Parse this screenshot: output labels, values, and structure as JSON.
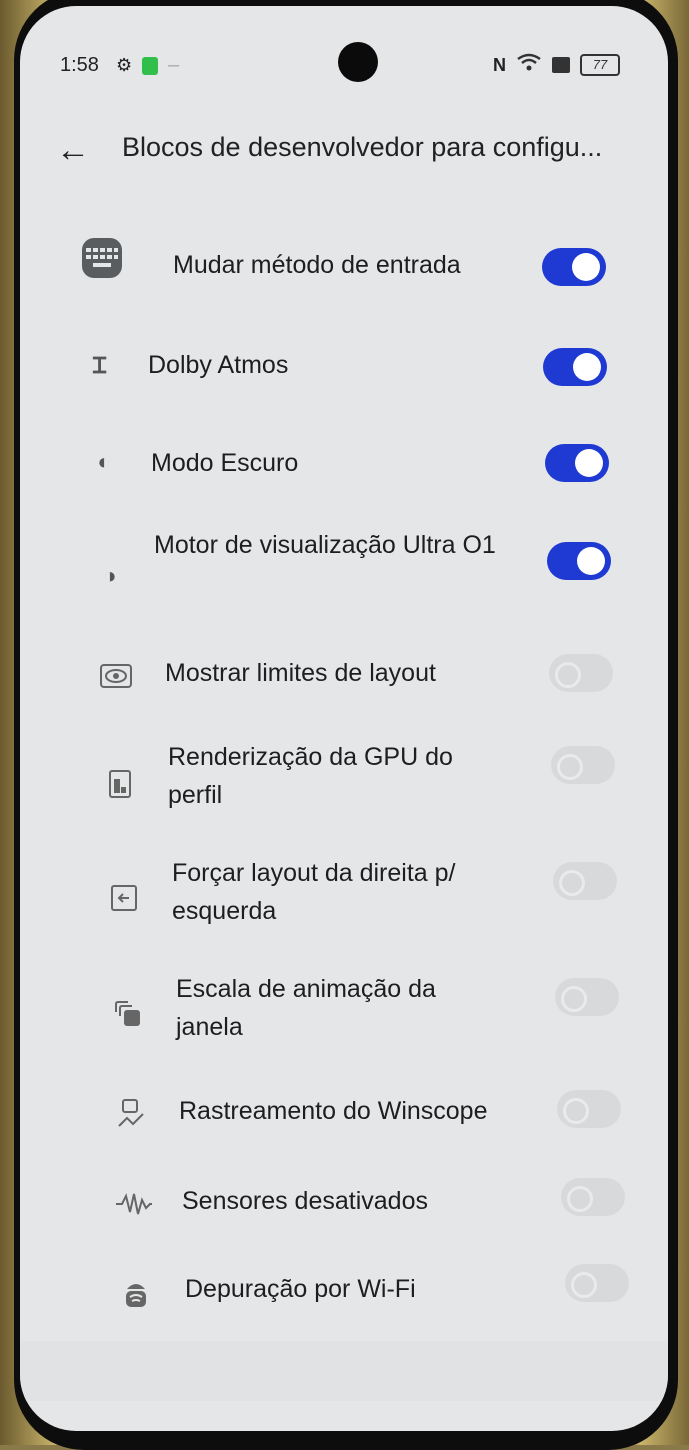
{
  "status_bar": {
    "time": "1:58",
    "battery": "77"
  },
  "header": {
    "back_icon": "back-arrow-icon",
    "title": "Blocos de desenvolvedor para configu..."
  },
  "tiles": [
    {
      "label": "Mudar método de entrada",
      "icon": "keyboard-icon",
      "enabled": true
    },
    {
      "label": "Dolby Atmos",
      "icon": "dolby-icon",
      "enabled": true
    },
    {
      "label": "Modo Escuro",
      "icon": "dark-mode-icon",
      "enabled": true
    },
    {
      "label": "Motor de visualização Ultra O1",
      "icon": "display-engine-icon",
      "enabled": true
    },
    {
      "label": "Mostrar limites de layout",
      "icon": "eye-icon",
      "enabled": false
    },
    {
      "label": "Renderização da GPU do perfil",
      "icon": "gpu-icon",
      "enabled": false
    },
    {
      "label": "Forçar layout da direita p/ esquerda",
      "icon": "rtl-layout-icon",
      "enabled": false
    },
    {
      "label": "Escala de animação da janela",
      "icon": "window-animation-icon",
      "enabled": false
    },
    {
      "label": "Rastreamento do Winscope",
      "icon": "winscope-icon",
      "enabled": false
    },
    {
      "label": "Sensores desativados",
      "icon": "sensors-off-icon",
      "enabled": false
    },
    {
      "label": "Depuração por Wi-Fi",
      "icon": "android-debug-icon",
      "enabled": false
    }
  ],
  "colors": {
    "toggle_on": "#1f3ad3",
    "toggle_off": "#d7d9db",
    "background": "#e4e6e8"
  }
}
